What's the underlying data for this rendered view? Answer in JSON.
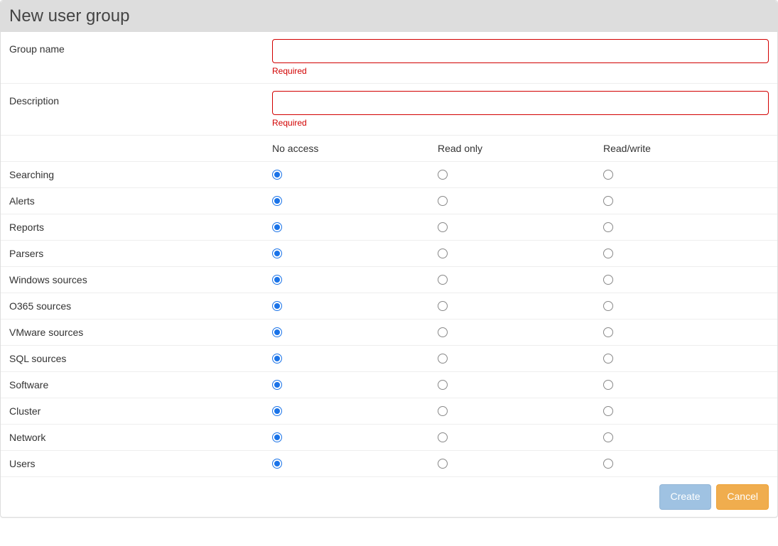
{
  "header": {
    "title": "New user group"
  },
  "form": {
    "group_name": {
      "label": "Group name",
      "value": "",
      "error": "Required"
    },
    "description": {
      "label": "Description",
      "value": "",
      "error": "Required"
    }
  },
  "permissions": {
    "columns": {
      "no_access": "No access",
      "read_only": "Read only",
      "read_write": "Read/write"
    },
    "rows": [
      {
        "label": "Searching",
        "selected": "no_access"
      },
      {
        "label": "Alerts",
        "selected": "no_access"
      },
      {
        "label": "Reports",
        "selected": "no_access"
      },
      {
        "label": "Parsers",
        "selected": "no_access"
      },
      {
        "label": "Windows sources",
        "selected": "no_access"
      },
      {
        "label": "O365 sources",
        "selected": "no_access"
      },
      {
        "label": "VMware sources",
        "selected": "no_access"
      },
      {
        "label": "SQL sources",
        "selected": "no_access"
      },
      {
        "label": "Software",
        "selected": "no_access"
      },
      {
        "label": "Cluster",
        "selected": "no_access"
      },
      {
        "label": "Network",
        "selected": "no_access"
      },
      {
        "label": "Users",
        "selected": "no_access"
      }
    ]
  },
  "footer": {
    "create_label": "Create",
    "cancel_label": "Cancel"
  }
}
